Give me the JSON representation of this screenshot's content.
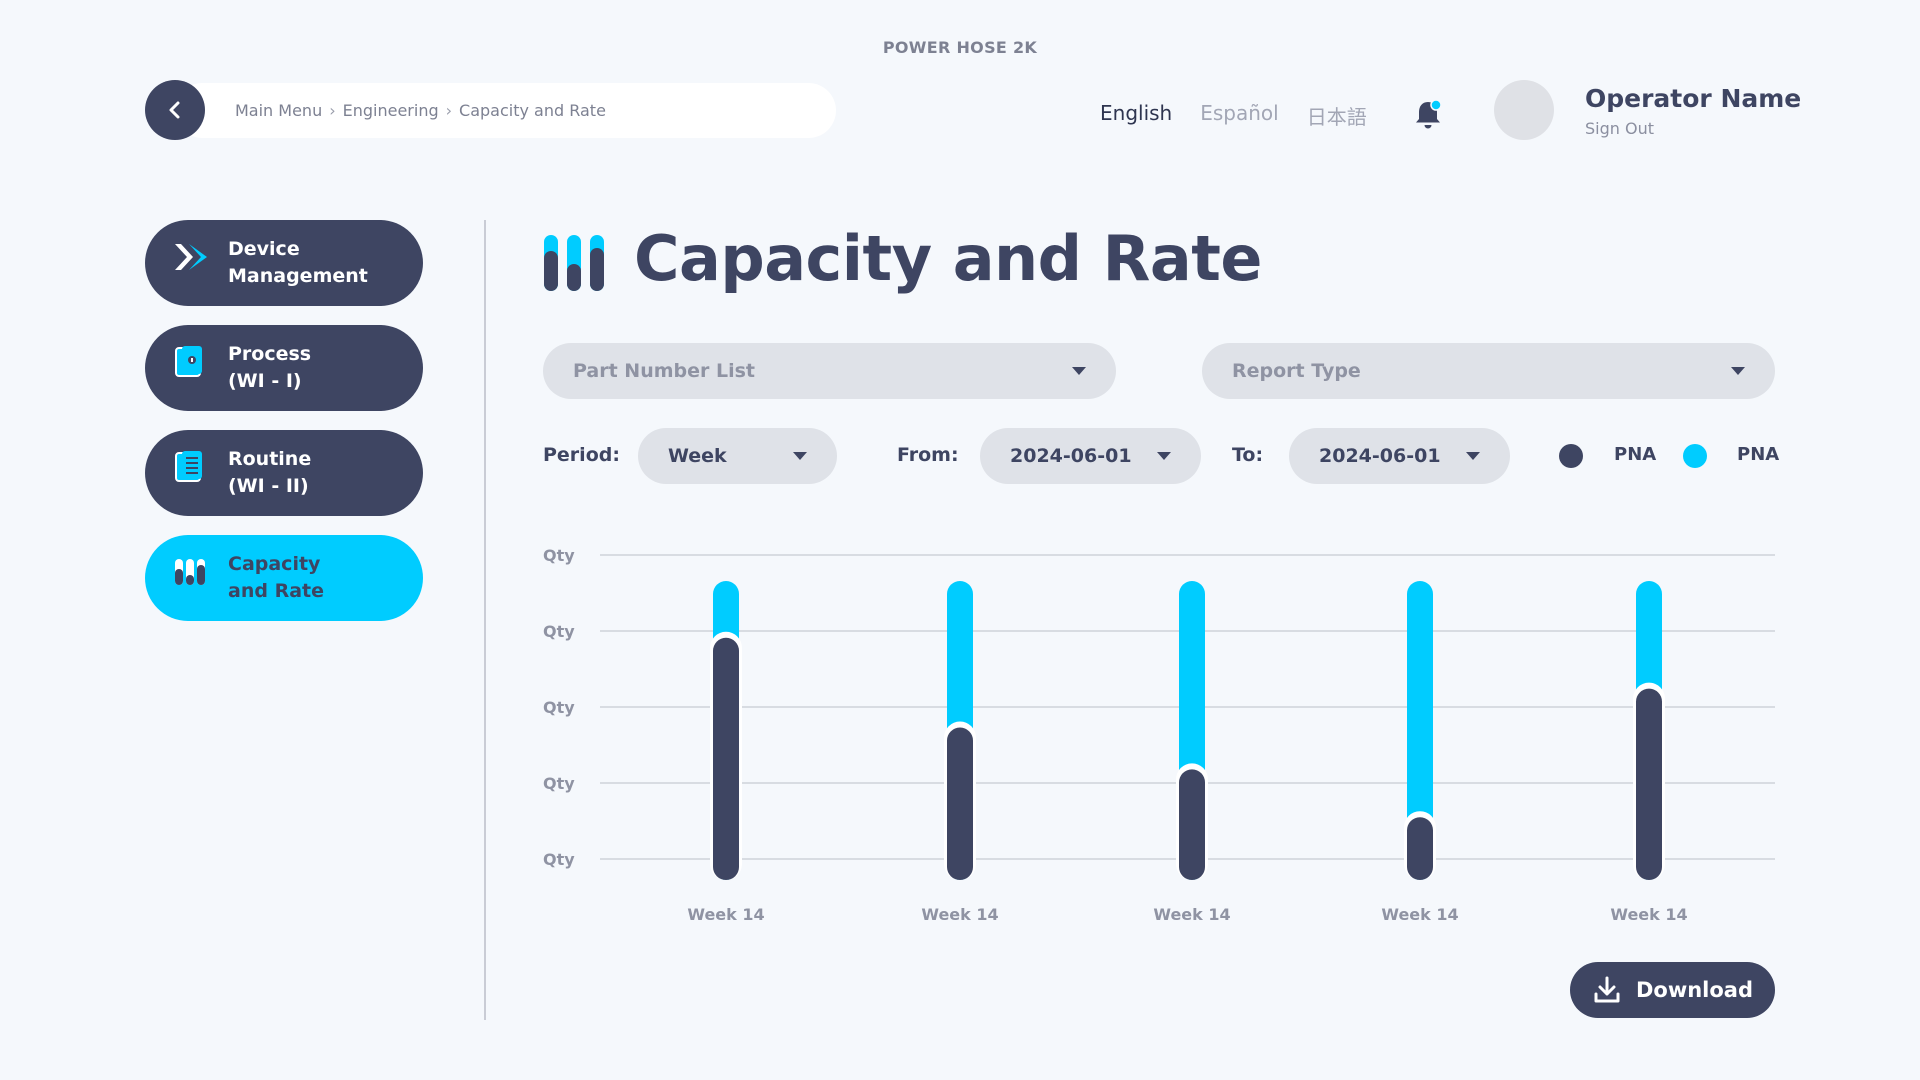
{
  "app": {
    "title": "POWER HOSE 2K"
  },
  "header": {
    "breadcrumb": [
      "Main Menu",
      "Engineering",
      "Capacity and Rate"
    ],
    "languages": [
      "English",
      "Español",
      "日本語"
    ],
    "active_language": "English",
    "user": {
      "name": "Operator Name",
      "sign_out": "Sign Out"
    }
  },
  "sidebar": {
    "items": [
      {
        "line1": "Device",
        "line2": "Management",
        "icon": "device-icon",
        "active": false
      },
      {
        "line1": "Process",
        "line2": "(WI - I)",
        "icon": "process-icon",
        "active": false
      },
      {
        "line1": "Routine",
        "line2": "(WI - II)",
        "icon": "routine-icon",
        "active": false
      },
      {
        "line1": "Capacity",
        "line2": "and Rate",
        "icon": "capacity-icon",
        "active": true
      }
    ]
  },
  "main": {
    "title": "Capacity and Rate",
    "part_number_placeholder": "Part Number List",
    "report_type_placeholder": "Report Type",
    "period_label": "Period:",
    "period_value": "Week",
    "from_label": "From:",
    "from_value": "2024-06-01",
    "to_label": "To:",
    "to_value": "2024-06-01",
    "download_label": "Download"
  },
  "colors": {
    "primary": "#3e4562",
    "accent": "#00ccff",
    "background": "#f5f8fc",
    "control": "#dfe2e8"
  },
  "chart_data": {
    "type": "bar",
    "stacked": true,
    "categories": [
      "Week 14",
      "Week 14",
      "Week 14",
      "Week 14",
      "Week 14"
    ],
    "y_tick_labels": [
      "Qty",
      "Qty",
      "Qty",
      "Qty",
      "Qty"
    ],
    "legend": [
      {
        "label": "PNA",
        "color": "#3e4562"
      },
      {
        "label": "PNA",
        "color": "#00ccff"
      }
    ],
    "legend_position": "top-right",
    "series": [
      {
        "name": "PNA",
        "color": "#3e4562",
        "values": [
          0.81,
          0.51,
          0.37,
          0.21,
          0.64
        ]
      },
      {
        "name": "PNA",
        "color": "#00ccff",
        "values": [
          0.19,
          0.49,
          0.63,
          0.79,
          0.36
        ]
      }
    ],
    "ylim": [
      0,
      1
    ],
    "grid": true
  }
}
